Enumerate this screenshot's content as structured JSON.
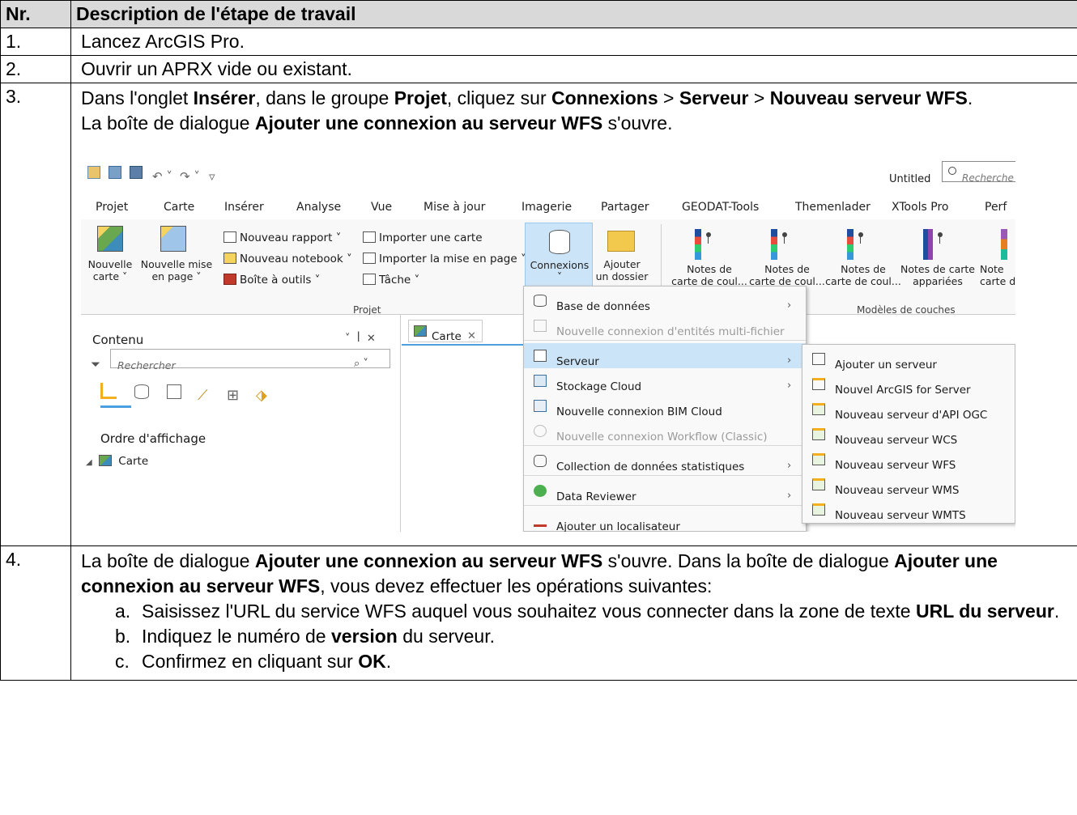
{
  "table": {
    "header": {
      "nr": "Nr.",
      "desc": "Description de l'étape de travail"
    },
    "step1": {
      "num": "1.",
      "text": "Lancez ArcGIS Pro."
    },
    "step2": {
      "num": "2.",
      "text": "Ouvrir un APRX vide ou existant."
    },
    "step3": {
      "num": "3.",
      "p1a": "Dans l'onglet ",
      "p1b": "Insérer",
      "p1c": ", dans le groupe ",
      "p1d": "Projet",
      "p1e": ", cliquez sur ",
      "p1f": "Connexions",
      "p1g": " > ",
      "p1h": "Serveur",
      "p1i": " > ",
      "p1j": "Nouveau serveur WFS",
      "p1k": ".",
      "p2a": "La boîte de dialogue ",
      "p2b": "Ajouter une connexion au serveur WFS",
      "p2c": " s'ouvre."
    },
    "step4": {
      "num": "4.",
      "p1a": "La boîte de dialogue ",
      "p1b": "Ajouter une connexion au serveur WFS",
      "p1c": " s'ouvre. Dans la boîte de dialogue ",
      "p1d": "Ajouter une connexion au serveur WFS",
      "p1e": ", vous devez effectuer les opérations suivantes:",
      "a_lt": "a.",
      "a1": "Saisissez l'URL du service WFS auquel vous souhaitez vous connecter dans la zone de texte ",
      "a2": "URL du serveur",
      "a3": ".",
      "b_lt": "b.",
      "b1": "Indiquez le numéro de ",
      "b2": "version",
      "b3": " du serveur.",
      "c_lt": "c.",
      "c1": "Confirmez en cliquant sur ",
      "c2": "OK",
      "c3": "."
    }
  },
  "shot": {
    "title": "Untitled",
    "search_placeholder": "Recherche",
    "tabs": [
      "Projet",
      "Carte",
      "Insérer",
      "Analyse",
      "Vue",
      "Mise à jour",
      "Imagerie",
      "Partager",
      "GEODAT-Tools",
      "Themenlader",
      "XTools Pro",
      "Perf"
    ],
    "ribbon": {
      "new_map": "Nouvelle\ncarte ˅",
      "new_layout": "Nouvelle mise\nen page ˅",
      "new_report": "Nouveau rapport ˅",
      "new_notebook": "Nouveau notebook ˅",
      "toolbox": "Boîte à outils ˅",
      "import_map": "Importer une carte",
      "import_layout": "Importer la mise en page ˅",
      "task": "Tâche ˅",
      "connections": "Connexions",
      "add_folder": "Ajouter\nun dossier",
      "group_project": "Projet",
      "group_layers": "Modèles de couches",
      "tpl1": "Notes de\ncarte de coul...",
      "tpl2": "Notes de\ncarte de coul...",
      "tpl3": "Notes de\ncarte de coul...",
      "tpl4": "Notes de carte\nappariées",
      "tpl5": "Note\ncarte d"
    },
    "pane": {
      "title": "Contenu",
      "search": "Rechercher",
      "order": "Ordre d'affichage",
      "item": "Carte"
    },
    "map_tab": "Carte",
    "menu": [
      {
        "label": "Base de données"
      },
      {
        "label": "Nouvelle connexion d'entités multi-fichier"
      },
      {
        "label": "Serveur"
      },
      {
        "label": "Stockage Cloud"
      },
      {
        "label": "Nouvelle connexion BIM Cloud"
      },
      {
        "label": "Nouvelle connexion Workflow (Classic)"
      },
      {
        "label": "Collection de données statistiques"
      },
      {
        "label": "Data Reviewer"
      },
      {
        "label": "Ajouter un localisateur"
      }
    ],
    "submenu": [
      "Ajouter un serveur",
      "Nouvel ArcGIS for Server",
      "Nouveau serveur d'API OGC",
      "Nouveau serveur WCS",
      "Nouveau serveur WFS",
      "Nouveau serveur WMS",
      "Nouveau serveur WMTS"
    ],
    "colors": {
      "highlight": "#cce4f7",
      "accent": "#4d9fe0"
    }
  }
}
